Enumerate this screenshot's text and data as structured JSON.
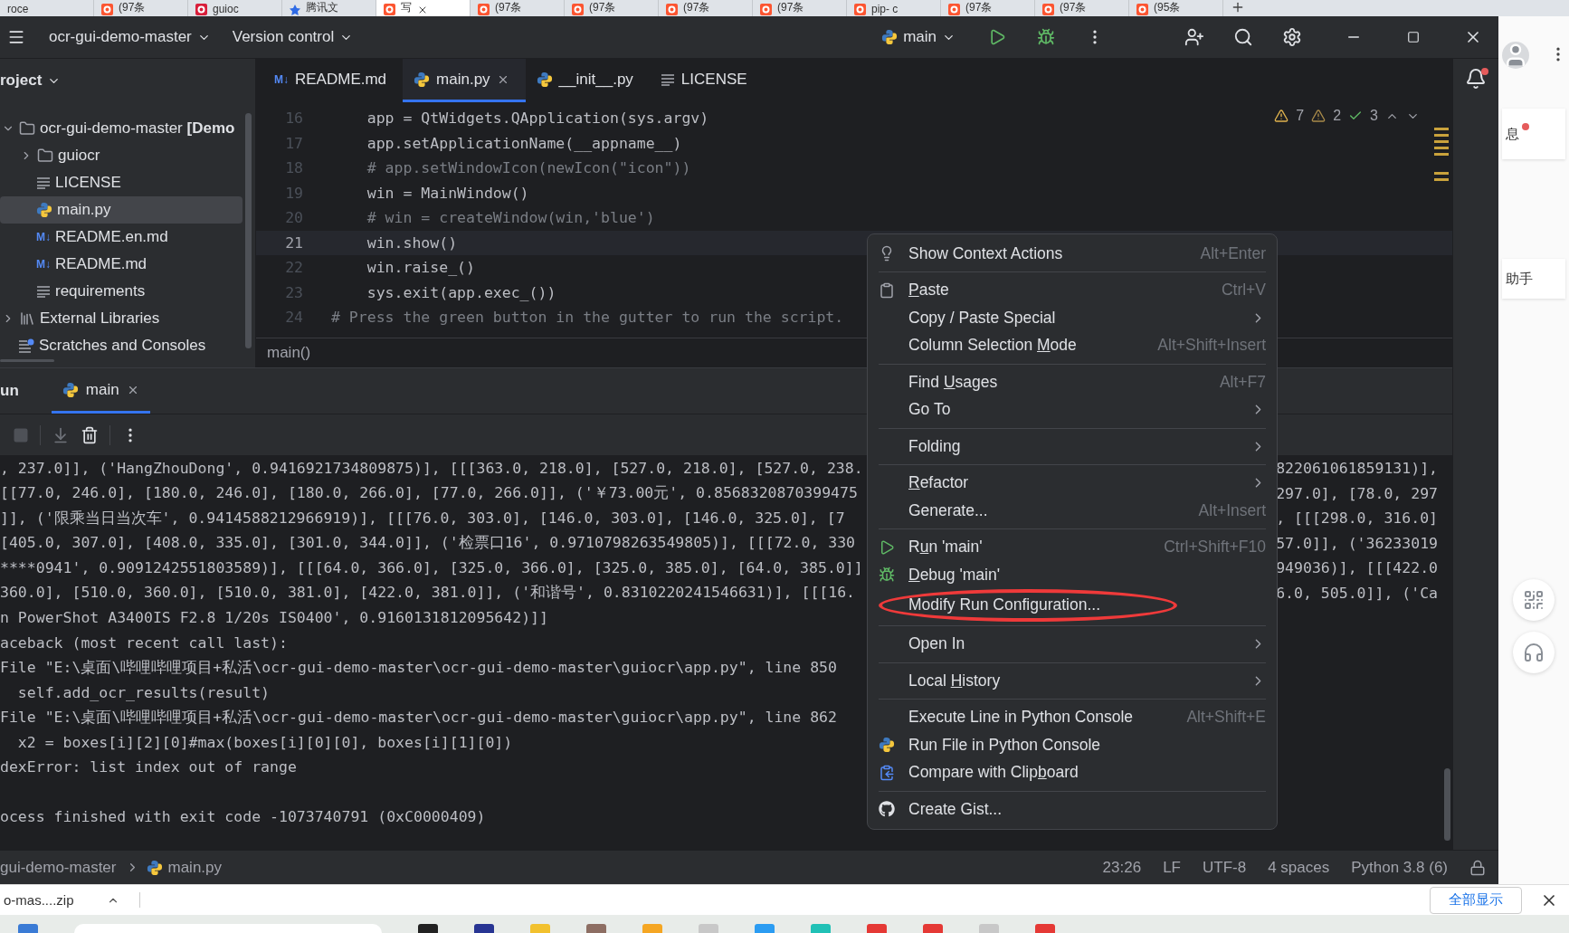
{
  "browser_tabs": [
    {
      "label": "roce",
      "kind": "page",
      "selected": false
    },
    {
      "label": "(97条",
      "kind": "csdn",
      "selected": false
    },
    {
      "label": "guioc",
      "kind": "ia",
      "selected": false
    },
    {
      "label": "腾讯文",
      "kind": "tencent",
      "selected": false
    },
    {
      "label": "写",
      "kind": "csdn",
      "selected": true
    },
    {
      "label": "(97条",
      "kind": "csdn",
      "selected": false
    },
    {
      "label": "(97条",
      "kind": "csdn",
      "selected": false
    },
    {
      "label": "(97条",
      "kind": "csdn",
      "selected": false
    },
    {
      "label": "(97条",
      "kind": "csdn",
      "selected": false
    },
    {
      "label": "pip- c",
      "kind": "csdn",
      "selected": false
    },
    {
      "label": "(97条",
      "kind": "csdn",
      "selected": false
    },
    {
      "label": "(97条",
      "kind": "csdn",
      "selected": false
    },
    {
      "label": "(95条",
      "kind": "csdn",
      "selected": false
    }
  ],
  "ide": {
    "project_name": "ocr-gui-demo-master",
    "vcs": "Version control",
    "run_config": "main",
    "project_panel": {
      "title": "roject",
      "tree": [
        {
          "label": "ocr-gui-demo-master **[Demo**",
          "kind": "folder",
          "expanded": true,
          "selected": false,
          "children": [
            {
              "label": "guiocr",
              "kind": "folder",
              "expanded": false,
              "selected": false
            },
            {
              "label": "LICENSE",
              "kind": "text",
              "selected": false
            },
            {
              "label": "main.py",
              "kind": "python",
              "selected": true
            },
            {
              "label": "README.en.md",
              "kind": "markdown",
              "icon_text": "M↓",
              "selected": false
            },
            {
              "label": "README.md",
              "kind": "markdown",
              "icon_text": "M↓",
              "selected": false
            },
            {
              "label": "requirements",
              "kind": "text",
              "selected": false
            }
          ]
        },
        {
          "label": "External Libraries",
          "kind": "library",
          "expanded": false,
          "selected": false
        },
        {
          "label": "Scratches and Consoles",
          "kind": "scratches",
          "selected": false
        }
      ]
    },
    "editor_tabs": [
      {
        "label": "README.md",
        "kind": "markdown",
        "icon_text": "M↓",
        "selected": false,
        "close_button": false
      },
      {
        "label": "main.py",
        "kind": "python",
        "selected": true,
        "close_button": true
      },
      {
        "label": "__init__.py",
        "kind": "python",
        "selected": false,
        "close_button": false
      },
      {
        "label": "LICENSE",
        "kind": "text",
        "selected": false,
        "close_button": false
      }
    ],
    "inspections": {
      "warnings": "7",
      "weak_warnings": "2",
      "typos": "3"
    },
    "code_lines": [
      {
        "number": "16",
        "text": "    app = QtWidgets.QApplication(sys.argv)",
        "kind": "code",
        "current": false
      },
      {
        "number": "17",
        "text": "    app.setApplicationName(__appname__)",
        "kind": "code",
        "current": false
      },
      {
        "number": "18",
        "text": "    # app.setWindowIcon(newIcon(\"icon\"))",
        "kind": "comment",
        "current": false
      },
      {
        "number": "19",
        "text": "    win = MainWindow()",
        "kind": "code",
        "current": false
      },
      {
        "number": "20",
        "text": "    # win = createWindow(win,'blue')",
        "kind": "comment",
        "current": false
      },
      {
        "number": "21",
        "text": "    win.show()",
        "kind": "code",
        "current": true
      },
      {
        "number": "22",
        "text": "    win.raise_()",
        "kind": "code",
        "current": false
      },
      {
        "number": "23",
        "text": "    sys.exit(app.exec_())",
        "kind": "code",
        "current": false
      },
      {
        "number": "24",
        "text": "# Press the green button in the gutter to run the script.",
        "kind": "comment",
        "current": false
      }
    ],
    "breadcrumb": "main()",
    "run_panel": {
      "title": "un",
      "tab": {
        "label": "main",
        "selected": true
      },
      "console": [
        {
          "kind": "output",
          "text": ", 237.0]], ('HangZhouDong', 0.9416921734809875)], [[[363.0, 218.0], [527.0, 218.0], [527.0, 238.",
          "tail": "822061061859131)],"
        },
        {
          "kind": "output",
          "text": "[[77.0, 246.0], [180.0, 246.0], [180.0, 266.0], [77.0, 266.0]], ('￥73.00元', 0.8568320870399475",
          "tail": "297.0], [78.0, 297"
        },
        {
          "kind": "output",
          "text": "]], ('限乘当日当次车', 0.9414588212966919)], [[[76.0, 303.0], [146.0, 303.0], [146.0, 325.0], [7",
          "tail": ", [[[298.0, 316.0]"
        },
        {
          "kind": "output",
          "text": "[405.0, 307.0], [408.0, 335.0], [301.0, 344.0]], ('检票口16', 0.9710798263549805)], [[[72.0, 330",
          "tail": "57.0]], ('36233019"
        },
        {
          "kind": "output",
          "text": "****0941', 0.9091242551803589)], [[[64.0, 366.0], [325.0, 366.0], [325.0, 385.0], [64.0, 385.0]]",
          "tail": "949036)], [[[422.0"
        },
        {
          "kind": "output",
          "text": "360.0], [510.0, 360.0], [510.0, 381.0], [422.0, 381.0]], ('和谐号', 0.8310220241546631)], [[[16.",
          "tail": "6.0, 505.0]], ('Ca"
        },
        {
          "kind": "output",
          "text": "n PowerShot A3400IS F2.8 1/20s IS0400', 0.9160131812095642)]]"
        },
        {
          "kind": "output",
          "text": "aceback (most recent call last):"
        },
        {
          "kind": "output",
          "text": "File \"E:\\桌面\\哔哩哔哩项目+私活\\ocr-gui-demo-master\\ocr-gui-demo-master\\guiocr\\app.py\", line 850"
        },
        {
          "kind": "output",
          "text": "  self.add_ocr_results(result)"
        },
        {
          "kind": "output",
          "text": "File \"E:\\桌面\\哔哩哔哩项目+私活\\ocr-gui-demo-master\\ocr-gui-demo-master\\guiocr\\app.py\", line 862"
        },
        {
          "kind": "output",
          "text": "  x2 = boxes[i][2][0]#max(boxes[i][0][0], boxes[i][1][0])"
        },
        {
          "kind": "output",
          "text": "dexError: list index out of range"
        },
        {
          "kind": "blank"
        },
        {
          "kind": "output",
          "text": "ocess finished with exit code -1073740791 (0xC0000409)"
        }
      ]
    },
    "status_bar": {
      "path": [
        "gui-demo-master",
        "main.py"
      ],
      "info": [
        "23:26",
        "LF",
        "UTF-8",
        "4 spaces",
        "Python 3.8 (6)"
      ]
    },
    "context_menu": [
      [
        {
          "label": "Show Context Actions",
          "kind": "bulb",
          "shortcut": "Alt+Enter",
          "submenu": false,
          "circled": false
        }
      ],
      [
        {
          "key": "P",
          "post": "aste",
          "kind": "clipboard",
          "shortcut": "Ctrl+V",
          "submenu": false,
          "circled": false
        },
        {
          "label": "Copy / Paste Special",
          "submenu": true,
          "circled": false
        },
        {
          "pre": "Column Selection ",
          "key": "M",
          "post": "ode",
          "shortcut": "Alt+Shift+Insert",
          "submenu": false,
          "circled": false
        }
      ],
      [
        {
          "pre": "Find ",
          "key": "U",
          "post": "sages",
          "shortcut": "Alt+F7",
          "submenu": false,
          "circled": false
        },
        {
          "label": "Go To",
          "submenu": true,
          "circled": false
        }
      ],
      [
        {
          "label": "Folding",
          "submenu": true,
          "circled": false
        }
      ],
      [
        {
          "key": "R",
          "post": "efactor",
          "submenu": true,
          "circled": false
        },
        {
          "label": "Generate...",
          "shortcut": "Alt+Insert",
          "submenu": false,
          "circled": false
        }
      ],
      [
        {
          "pre": "R",
          "key": "u",
          "post": "n 'main'",
          "kind": "run",
          "shortcut": "Ctrl+Shift+F10",
          "submenu": false,
          "circled": false
        },
        {
          "key": "D",
          "post": "ebug 'main'",
          "kind": "debug",
          "submenu": false,
          "circled": false
        },
        {
          "label": "Modify Run Configuration...",
          "submenu": false,
          "circled": true
        }
      ],
      [
        {
          "label": "Open In",
          "submenu": true,
          "circled": false
        }
      ],
      [
        {
          "pre": "Local ",
          "key": "H",
          "post": "istory",
          "submenu": true,
          "circled": false
        }
      ],
      [
        {
          "label": "Execute Line in Python Console",
          "shortcut": "Alt+Shift+E",
          "submenu": false,
          "circled": false
        },
        {
          "label": "Run File in Python Console",
          "kind": "python",
          "submenu": false,
          "circled": false
        },
        {
          "pre": "Compare with Clip",
          "key": "b",
          "post": "oard",
          "kind": "compare",
          "submenu": false,
          "circled": false
        }
      ],
      [
        {
          "label": "Create Gist...",
          "kind": "github",
          "submenu": false,
          "circled": false
        }
      ]
    ]
  },
  "side_page": {
    "texts": [
      "息",
      "助手"
    ]
  },
  "download_bar": {
    "file": "o-mas....zip",
    "show_all": "全部显示"
  }
}
